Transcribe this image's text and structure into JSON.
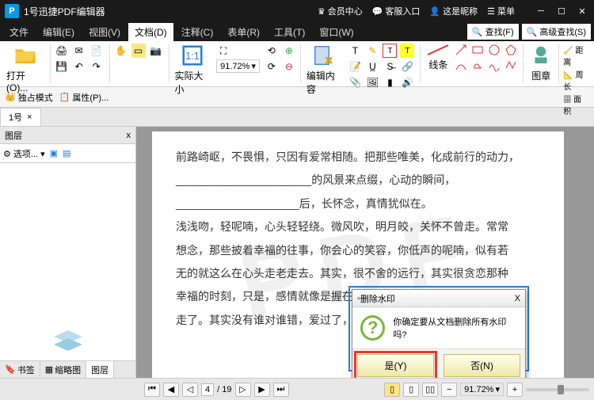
{
  "app": {
    "logo": "P",
    "title": "1号迅捷PDF编辑器"
  },
  "titlebar_right": {
    "vip": "会员中心",
    "service": "客服入口",
    "nickname": "这是昵称",
    "menu": "菜单"
  },
  "menus": [
    "文件",
    "编辑(E)",
    "视图(V)",
    "文档(D)",
    "注释(C)",
    "表单(R)",
    "工具(T)",
    "窗口(W)"
  ],
  "menu_active_index": 3,
  "find": {
    "find": "查找(F)",
    "adv": "高级查找(S)"
  },
  "ribbon": {
    "open": "打开(O)...",
    "realsize": "实际大小",
    "zoom": "91.72%",
    "edit_content": "编辑内容",
    "line": "线条",
    "stamp": "图章",
    "distance": "距离",
    "perimeter": "周长",
    "area": "面积"
  },
  "toolbar2": {
    "exclusive": "独占模式",
    "props": "属性(P)..."
  },
  "doc_tab": {
    "label": "1号",
    "close": "×"
  },
  "sidebar": {
    "title": "图层",
    "options": "选项...",
    "close": "x",
    "tabs": [
      "书签",
      "缩略图",
      "图层"
    ],
    "active_tab": 2
  },
  "dialog": {
    "title": "删除水印",
    "msg": "你确定要从文档删除所有水印吗?",
    "yes": "是(Y)",
    "no": "否(N)",
    "close": "X"
  },
  "status": {
    "page_current": "4",
    "page_total": "19",
    "zoom": "91.72%"
  },
  "document_text": [
    "前路崎岖，不畏惧，只因有爱常相随。把那些唯美，化成前行的动力，",
    "______________________的风景来点缀，心动的瞬间，",
    "",
    "",
    "____________________后，长怀念，真情犹似在。",
    "浅浅吻，轻呢喃，心头轻轻绕。微风吹，明月皎，关怀不曾走。常常",
    "想念，那些披着幸福的往事，你会心的笑容，你低声的呢喃，似有若",
    "无的就这么在心头走老走去。其实，很不舍的远行，其实很贪恋那种",
    "幸福的时刻，只是，感情就像是握在手里的沙，慢慢的，顺着指缝溜",
    "走了。其实没有谁对谁错，爱过了，珍惜了，幸福了，开心了，遗憾"
  ],
  "watermark_text": "PDF"
}
